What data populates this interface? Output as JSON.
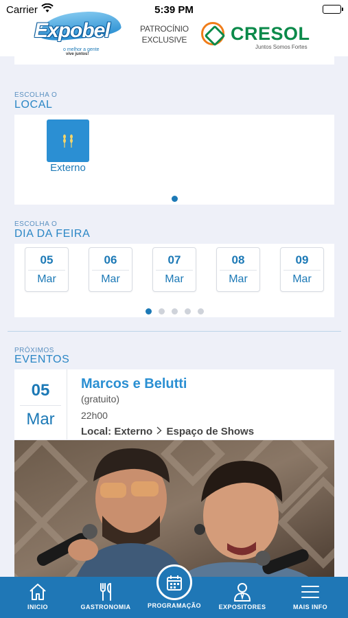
{
  "status_bar": {
    "carrier": "Carrier",
    "time": "5:39 PM"
  },
  "header": {
    "logo": {
      "name": "Expobel",
      "tagline_1": "o melhor a gente",
      "tagline_2": "vive juntos!"
    },
    "sponsor_line_1": "PATROCÍNIO",
    "sponsor_line_2": "EXCLUSIVE",
    "sponsor_name": "CRESOL",
    "sponsor_tagline": "Juntos Somos Fortes"
  },
  "local_section": {
    "small_label": "ESCOLHA O",
    "big_label": "LOCAL",
    "items": [
      {
        "label": "Externo",
        "icon": "wheat-icon"
      }
    ]
  },
  "days_section": {
    "small_label": "ESCOLHA O",
    "big_label": "DIA DA FEIRA",
    "days": [
      {
        "day": "05",
        "month": "Mar"
      },
      {
        "day": "06",
        "month": "Mar"
      },
      {
        "day": "07",
        "month": "Mar"
      },
      {
        "day": "08",
        "month": "Mar"
      },
      {
        "day": "09",
        "month": "Mar"
      }
    ],
    "page_count": 5,
    "active_page": 1
  },
  "events_section": {
    "small_label": "PRÓXIMOS",
    "big_label": "EVENTOS",
    "event": {
      "day": "05",
      "month": "Mar",
      "title": "Marcos e Belutti",
      "subtitle": "(gratuito)",
      "time": "22h00",
      "location": "Local: Externo",
      "venue": "Espaço de Shows"
    }
  },
  "tab_bar": {
    "items": [
      {
        "label": "INICIO",
        "icon": "home-icon"
      },
      {
        "label": "GASTRONOMIA",
        "icon": "cutlery-icon"
      },
      {
        "label": "PROGRAMAÇÃO",
        "icon": "calendar-icon"
      },
      {
        "label": "EXPOSITORES",
        "icon": "exhibitor-icon"
      },
      {
        "label": "MAIS INFO",
        "icon": "menu-icon"
      }
    ]
  },
  "colors": {
    "primary": "#1f77b6",
    "accent": "#2a8fd2",
    "background": "#eef0f8",
    "sponsor_green": "#0b8a4a",
    "sponsor_orange": "#f07d1a"
  }
}
